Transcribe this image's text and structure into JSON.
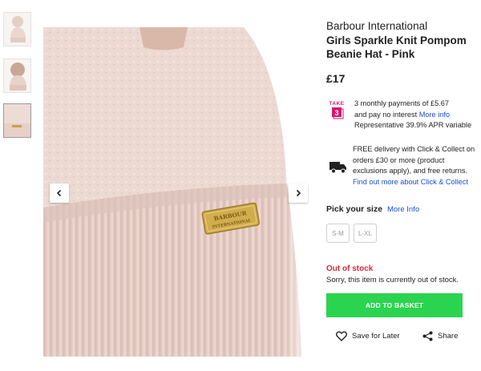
{
  "product": {
    "brand": "Barbour International",
    "name_line1": "Girls Sparkle Knit Pompom",
    "name_line2": "Beanie Hat - Pink",
    "price": "£17"
  },
  "image_alt": "",
  "gallery": {
    "thumbnails": [
      "thumbnail-1",
      "thumbnail-2",
      "thumbnail-3"
    ],
    "selected_index": 2,
    "logo_plate": [
      "BARBOUR",
      "INTERNATIONAL"
    ]
  },
  "finance": {
    "logo_top": "TAKE",
    "logo_num": "3",
    "line1": "3 monthly payments of £5.67",
    "line2": "and pay no interest ",
    "more_info": "More info",
    "line3": "Representative 39.9% APR variable"
  },
  "delivery": {
    "line1": "FREE delivery with Click & Collect on",
    "line2": "orders £30 or more (product",
    "line3": "exclusions apply), and free returns.",
    "link": "Find out more about Click & Collect"
  },
  "size_picker": {
    "label": "Pick your size",
    "more_info": "More Info",
    "options": [
      "S-M",
      "L-XL"
    ]
  },
  "stock": {
    "status": "Out of stock",
    "message": "Sorry, this item is currently out of stock."
  },
  "buttons": {
    "add_to_basket": "ADD TO BASKET",
    "save": "Save for Later",
    "share": "Share"
  },
  "colors": {
    "accent_green": "#2bd44f",
    "oos_red": "#e0263a",
    "link_blue": "#1a4ed3",
    "take3_magenta": "#d6196b"
  }
}
